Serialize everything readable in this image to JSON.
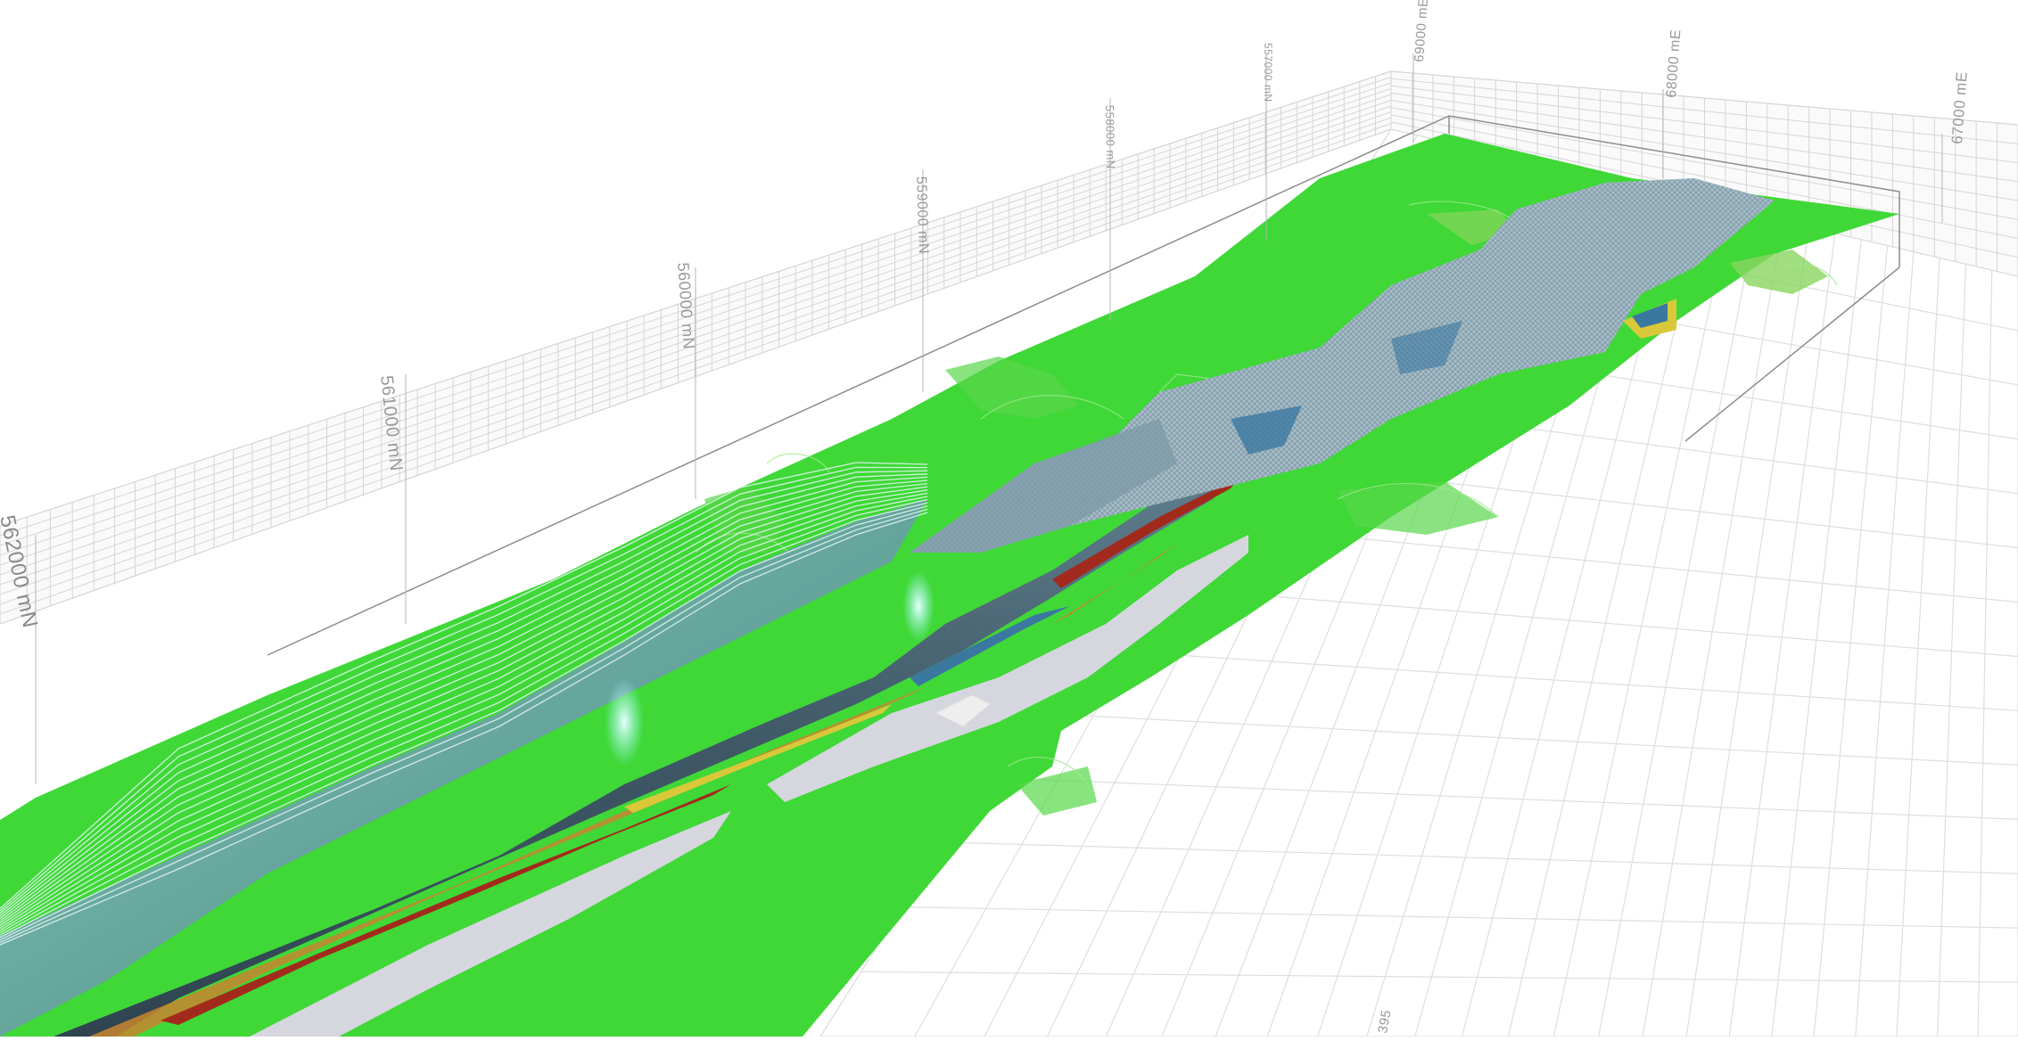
{
  "viewer": {
    "northing_labels": [
      "562000 mN",
      "561000 mN",
      "560000 mN",
      "559000 mN",
      "558000 mN",
      "557000 mN"
    ],
    "easting_labels": [
      "69000 mE",
      "68000 mE",
      "67000 mE"
    ],
    "bottom_labels": [
      "395"
    ],
    "colors": {
      "background": "#ffffff",
      "terrain_green": "#3fd837",
      "terrain_light_green": "#7fe56a",
      "block_model_grey": "#9bb3bf",
      "section_dark": "#3f5866",
      "section_red": "#a22a1c",
      "section_orange": "#c9852f",
      "section_yellow": "#d9c93a",
      "grid_line": "#d2d2d2"
    }
  }
}
